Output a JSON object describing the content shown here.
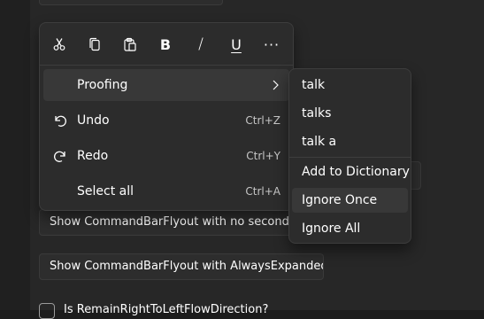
{
  "command_bar": {
    "buttons": [
      {
        "icon": "cut-icon",
        "label": "Cut"
      },
      {
        "icon": "copy-icon",
        "label": "Copy"
      },
      {
        "icon": "paste-icon",
        "label": "Paste"
      },
      {
        "icon": "bold-icon",
        "label": "B"
      },
      {
        "icon": "italic-icon",
        "label": "/"
      },
      {
        "icon": "underline-icon",
        "label": "U"
      },
      {
        "icon": "more-icon",
        "label": "···"
      }
    ]
  },
  "menu": {
    "items": [
      {
        "label": "Proofing",
        "accelerator": "",
        "icon": "",
        "has_submenu": true
      },
      {
        "label": "Undo",
        "accelerator": "Ctrl+Z",
        "icon": "undo-icon"
      },
      {
        "label": "Redo",
        "accelerator": "Ctrl+Y",
        "icon": "redo-icon"
      },
      {
        "label": "Select all",
        "accelerator": "Ctrl+A",
        "icon": ""
      }
    ]
  },
  "proofing_submenu": {
    "suggestions": [
      "talk",
      "talks",
      "talk a"
    ],
    "actions": [
      "Add to Dictionary",
      "Ignore Once",
      "Ignore All"
    ],
    "highlighted": "Ignore Once"
  },
  "background": {
    "button_no_secondary": "Show CommandBarFlyout with no secondary commands",
    "button_always_expanded": "Show CommandBarFlyout with AlwaysExpanded",
    "checkbox_label": "Is RemainRightToLeftFlowDirection?"
  },
  "colors": {
    "background": "#272727",
    "flyout": "#2c2c2c",
    "highlight": "#383838",
    "text": "#ffffff"
  }
}
